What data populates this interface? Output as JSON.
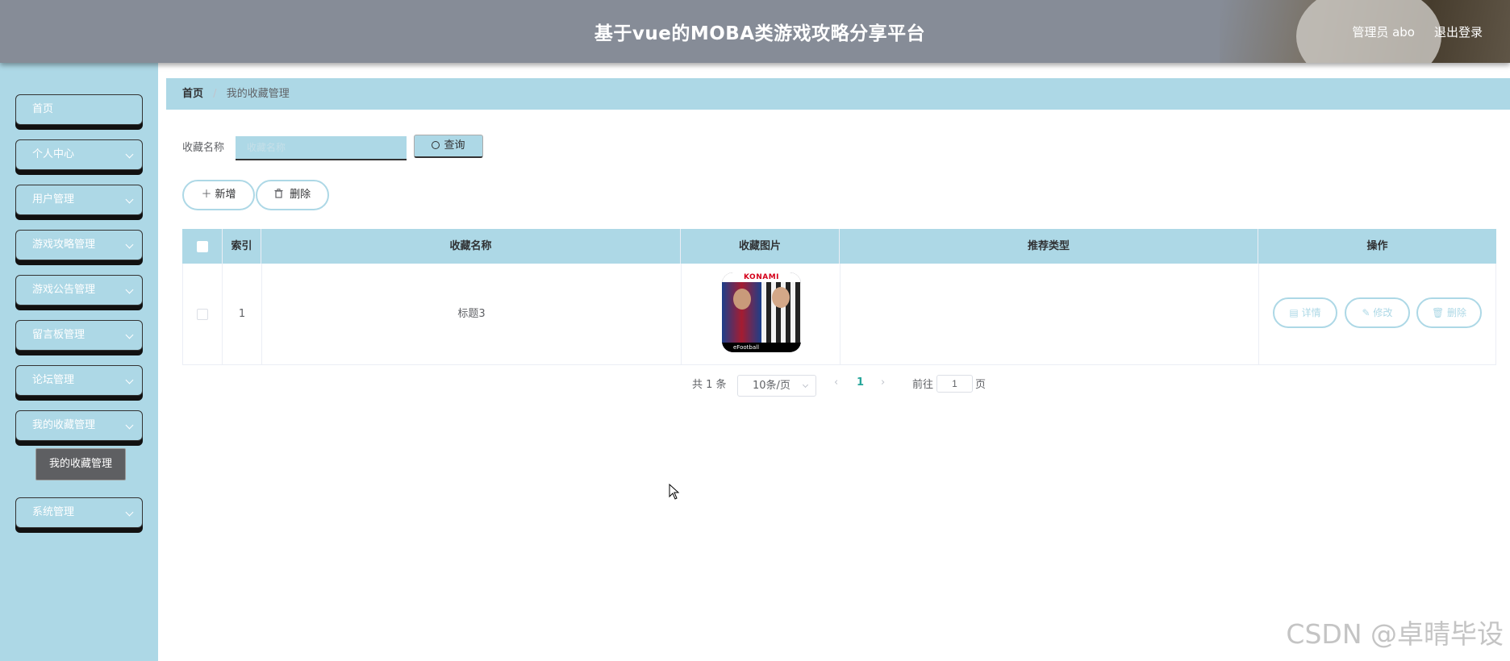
{
  "header": {
    "title": "基于vue的MOBA类游戏攻略分享平台",
    "admin_label": "管理员 abo",
    "logout_label": "退出登录"
  },
  "sidebar": {
    "items": [
      {
        "label": "首页",
        "has_children": false
      },
      {
        "label": "个人中心",
        "has_children": true
      },
      {
        "label": "用户管理",
        "has_children": true
      },
      {
        "label": "游戏攻略管理",
        "has_children": true
      },
      {
        "label": "游戏公告管理",
        "has_children": true
      },
      {
        "label": "留言板管理",
        "has_children": true
      },
      {
        "label": "论坛管理",
        "has_children": true
      },
      {
        "label": "我的收藏管理",
        "has_children": true,
        "expanded": true
      },
      {
        "label": "系统管理",
        "has_children": true
      }
    ],
    "active_submenu": "我的收藏管理"
  },
  "breadcrumb": {
    "home": "首页",
    "separator": "/",
    "current": "我的收藏管理"
  },
  "search": {
    "label": "收藏名称",
    "placeholder": "收藏名称",
    "value": "",
    "button_label": "查询"
  },
  "actions": {
    "add_label": "新增",
    "delete_label": "删除"
  },
  "table": {
    "columns": [
      "",
      "索引",
      "收藏名称",
      "收藏图片",
      "推荐类型",
      "操作"
    ],
    "rows": [
      {
        "index": "1",
        "name": "标题3",
        "image": {
          "top_text": "KONAMI",
          "bottom_text": "eFootball"
        },
        "recommend_type": "",
        "ops": [
          "详情",
          "修改",
          "删除"
        ]
      }
    ]
  },
  "pagination": {
    "total_label": "共 1 条",
    "page_size_label": "10条/页",
    "current_page": "1",
    "goto_label": "前往",
    "goto_value": "1",
    "page_suffix": "页"
  },
  "watermark": "CSDN @卓晴毕设",
  "colors": {
    "accent": "#add8e6",
    "header_bg": "#868c97",
    "submenu_active": "#5e5f62",
    "page_active": "#26a69a"
  }
}
